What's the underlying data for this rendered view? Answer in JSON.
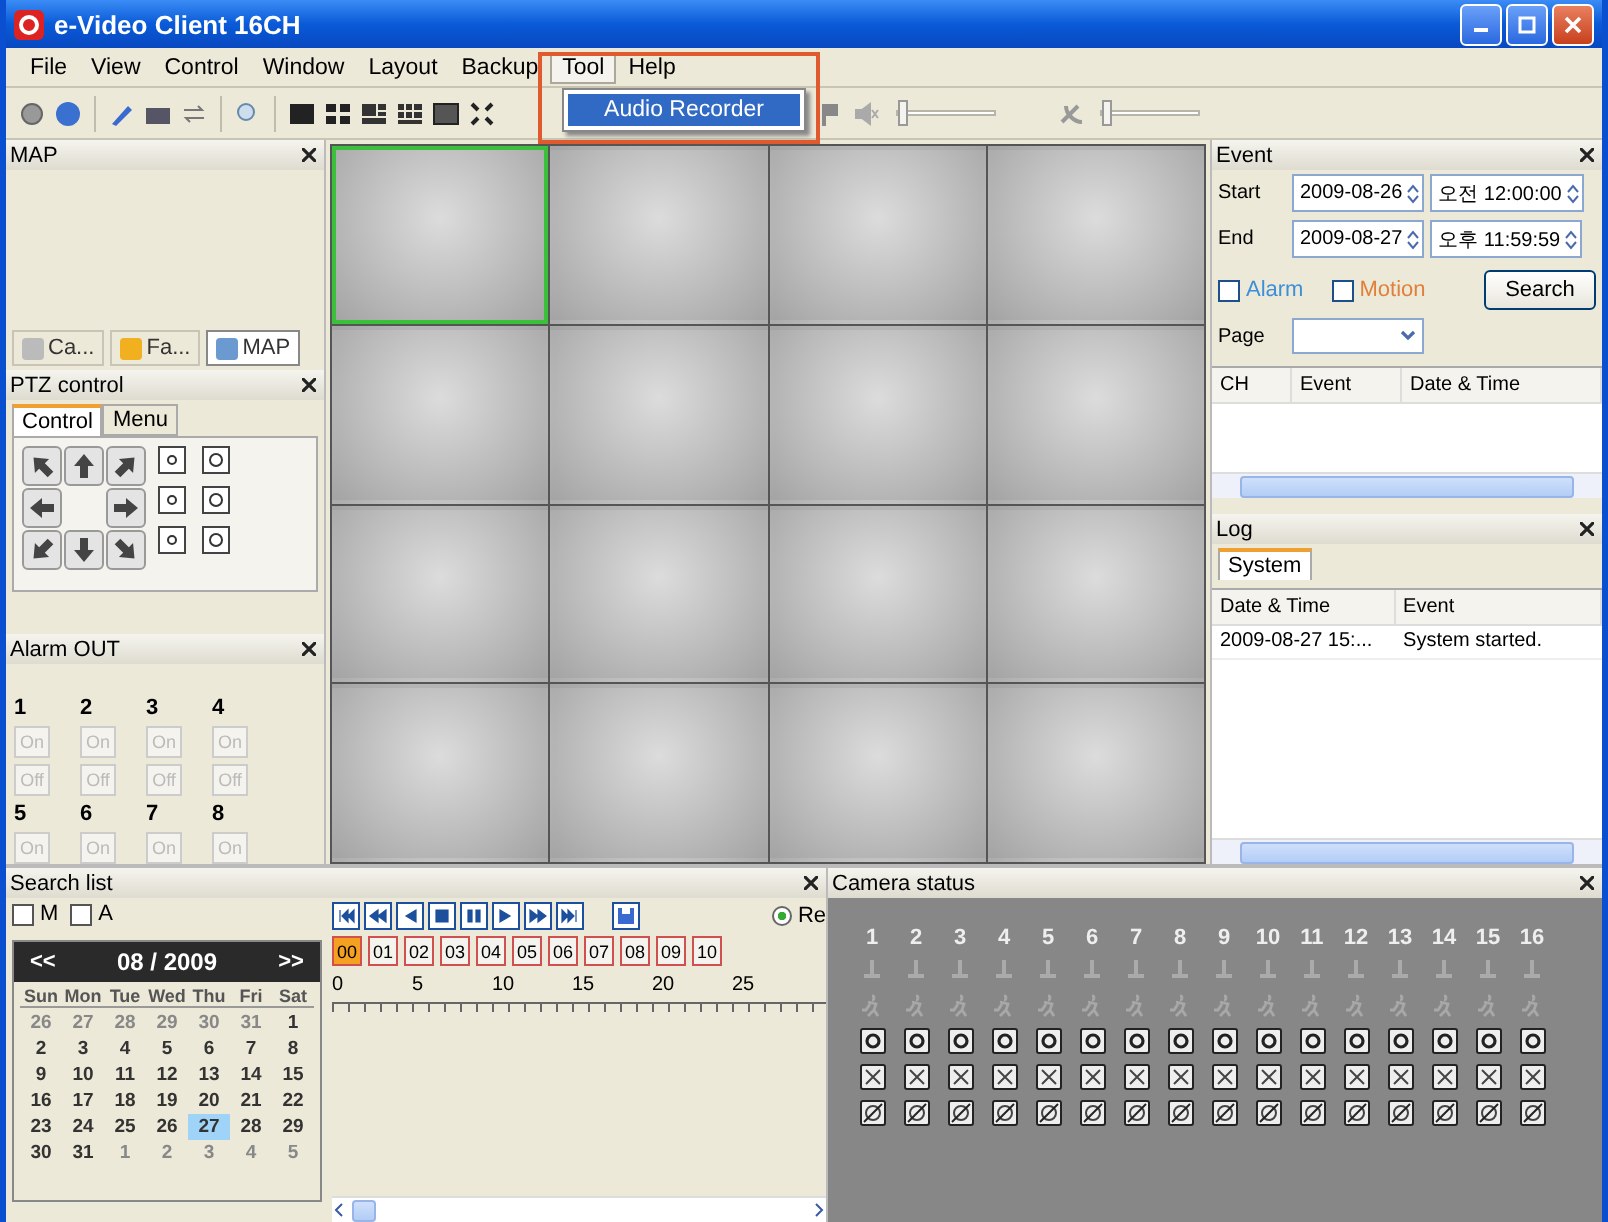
{
  "window": {
    "title": "e-Video Client 16CH"
  },
  "menu": [
    {
      "label": "File",
      "selected": false
    },
    {
      "label": "View",
      "selected": false
    },
    {
      "label": "Control",
      "selected": false
    },
    {
      "label": "Window",
      "selected": false
    },
    {
      "label": "Layout",
      "selected": false
    },
    {
      "label": "Backup",
      "selected": false
    },
    {
      "label": "Tool",
      "selected": true
    },
    {
      "label": "Help",
      "selected": false
    }
  ],
  "open_menu": {
    "items": [
      {
        "label": "Audio Recorder",
        "selected": true
      }
    ]
  },
  "toolbar": {
    "sliders": [
      {
        "level": 0
      },
      {
        "level": 0
      }
    ]
  },
  "map_panel": {
    "title": "MAP",
    "tabs": [
      {
        "label": "Ca...",
        "selected": false
      },
      {
        "label": "Fa...",
        "selected": false
      },
      {
        "label": "MAP",
        "selected": true
      }
    ]
  },
  "ptz_panel": {
    "title": "PTZ control",
    "tabs": [
      {
        "label": "Control",
        "selected": true
      },
      {
        "label": "Menu",
        "selected": false
      }
    ]
  },
  "alarm_out": {
    "title": "Alarm OUT",
    "channels": [
      {
        "number": "1",
        "on": "On",
        "off": "Off"
      },
      {
        "number": "2",
        "on": "On",
        "off": "Off"
      },
      {
        "number": "3",
        "on": "On",
        "off": "Off"
      },
      {
        "number": "4",
        "on": "On",
        "off": "Off"
      },
      {
        "number": "5",
        "on": "On"
      },
      {
        "number": "6",
        "on": "On"
      },
      {
        "number": "7",
        "on": "On"
      },
      {
        "number": "8",
        "on": "On"
      }
    ]
  },
  "video_grid": {
    "tiles": [
      {
        "selected": true
      },
      {
        "selected": false
      },
      {
        "selected": false
      },
      {
        "selected": false
      },
      {
        "selected": false
      },
      {
        "selected": false
      },
      {
        "selected": false
      },
      {
        "selected": false
      },
      {
        "selected": false
      },
      {
        "selected": false
      },
      {
        "selected": false
      },
      {
        "selected": false
      },
      {
        "selected": false
      },
      {
        "selected": false
      },
      {
        "selected": false
      },
      {
        "selected": false
      }
    ]
  },
  "event_panel": {
    "title": "Event",
    "start_label": "Start",
    "start_date": "2009-08-26",
    "start_time": "오전 12:00:00",
    "end_label": "End",
    "end_date": "2009-08-27",
    "end_time": "오후 11:59:59",
    "filters": [
      {
        "label": "Alarm",
        "checked": false,
        "color": "#3c8fd8"
      },
      {
        "label": "Motion",
        "checked": false,
        "color": "#e0803a"
      }
    ],
    "search_button": "Search",
    "page_label": "Page",
    "columns": [
      "CH",
      "Event",
      "Date & Time"
    ]
  },
  "log_panel": {
    "title": "Log",
    "tabs": [
      {
        "label": "System",
        "selected": true
      }
    ],
    "columns": [
      "Date & Time",
      "Event"
    ],
    "rows": [
      [
        "2009-08-27 15:...",
        "System started."
      ]
    ]
  },
  "search_list": {
    "title": "Search list",
    "filters": [
      {
        "label": "M",
        "checked": false
      },
      {
        "label": "A",
        "checked": false
      }
    ],
    "calendar": {
      "prev": "<<",
      "month": "08 / 2009",
      "next": ">>",
      "weekdays": [
        "Sun",
        "Mon",
        "Tue",
        "Wed",
        "Thu",
        "Fri",
        "Sat"
      ],
      "days": [
        {
          "label": "26",
          "muted": true,
          "selected": false
        },
        {
          "label": "27",
          "muted": true,
          "selected": false
        },
        {
          "label": "28",
          "muted": true,
          "selected": false
        },
        {
          "label": "29",
          "muted": true,
          "selected": false
        },
        {
          "label": "30",
          "muted": true,
          "selected": false
        },
        {
          "label": "31",
          "muted": true,
          "selected": false
        },
        {
          "label": "1",
          "muted": false,
          "selected": false
        },
        {
          "label": "2",
          "muted": false,
          "selected": false
        },
        {
          "label": "3",
          "muted": false,
          "selected": false
        },
        {
          "label": "4",
          "muted": false,
          "selected": false
        },
        {
          "label": "5",
          "muted": false,
          "selected": false
        },
        {
          "label": "6",
          "muted": false,
          "selected": false
        },
        {
          "label": "7",
          "muted": false,
          "selected": false
        },
        {
          "label": "8",
          "muted": false,
          "selected": false
        },
        {
          "label": "9",
          "muted": false,
          "selected": false
        },
        {
          "label": "10",
          "muted": false,
          "selected": false
        },
        {
          "label": "11",
          "muted": false,
          "selected": false
        },
        {
          "label": "12",
          "muted": false,
          "selected": false
        },
        {
          "label": "13",
          "muted": false,
          "selected": false
        },
        {
          "label": "14",
          "muted": false,
          "selected": false
        },
        {
          "label": "15",
          "muted": false,
          "selected": false
        },
        {
          "label": "16",
          "muted": false,
          "selected": false
        },
        {
          "label": "17",
          "muted": false,
          "selected": false
        },
        {
          "label": "18",
          "muted": false,
          "selected": false
        },
        {
          "label": "19",
          "muted": false,
          "selected": false
        },
        {
          "label": "20",
          "muted": false,
          "selected": false
        },
        {
          "label": "21",
          "muted": false,
          "selected": false
        },
        {
          "label": "22",
          "muted": false,
          "selected": false
        },
        {
          "label": "23",
          "muted": false,
          "selected": false
        },
        {
          "label": "24",
          "muted": false,
          "selected": false
        },
        {
          "label": "25",
          "muted": false,
          "selected": false
        },
        {
          "label": "26",
          "muted": false,
          "selected": false
        },
        {
          "label": "27",
          "muted": false,
          "selected": true
        },
        {
          "label": "28",
          "muted": false,
          "selected": false
        },
        {
          "label": "29",
          "muted": false,
          "selected": false
        },
        {
          "label": "30",
          "muted": false,
          "selected": false
        },
        {
          "label": "31",
          "muted": false,
          "selected": false
        },
        {
          "label": "1",
          "muted": true,
          "selected": false
        },
        {
          "label": "2",
          "muted": true,
          "selected": false
        },
        {
          "label": "3",
          "muted": true,
          "selected": false
        },
        {
          "label": "4",
          "muted": true,
          "selected": false
        },
        {
          "label": "5",
          "muted": true,
          "selected": false
        }
      ]
    },
    "channels": [
      {
        "label": "00",
        "selected": true
      },
      {
        "label": "01",
        "selected": false
      },
      {
        "label": "02",
        "selected": false
      },
      {
        "label": "03",
        "selected": false
      },
      {
        "label": "04",
        "selected": false
      },
      {
        "label": "05",
        "selected": false
      },
      {
        "label": "06",
        "selected": false
      },
      {
        "label": "07",
        "selected": false
      },
      {
        "label": "08",
        "selected": false
      },
      {
        "label": "09",
        "selected": false
      },
      {
        "label": "10",
        "selected": false
      }
    ],
    "radio": {
      "label": "Re",
      "selected": true
    },
    "ticks": [
      "0",
      "5",
      "10",
      "15",
      "20",
      "25"
    ]
  },
  "camera_status": {
    "title": "Camera status",
    "channels": [
      "1",
      "2",
      "3",
      "4",
      "5",
      "6",
      "7",
      "8",
      "9",
      "10",
      "11",
      "12",
      "13",
      "14",
      "15",
      "16"
    ]
  }
}
